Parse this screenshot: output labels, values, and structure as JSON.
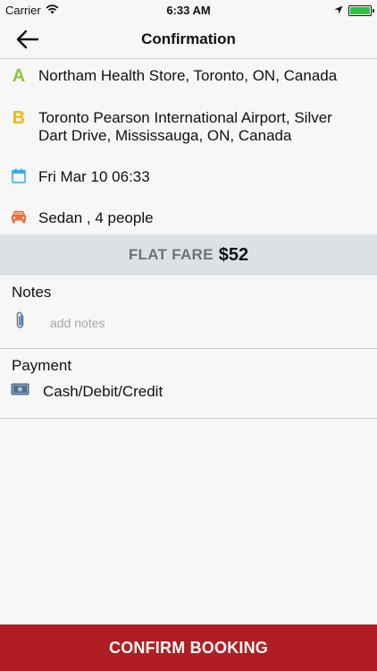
{
  "status_bar": {
    "carrier": "Carrier",
    "time": "6:33 AM"
  },
  "nav": {
    "title": "Confirmation"
  },
  "trip": {
    "pickup_letter": "A",
    "pickup": "Northam Health Store, Toronto, ON, Canada",
    "dropoff_letter": "B",
    "dropoff": "Toronto Pearson International Airport, Silver Dart Drive, Mississauga, ON, Canada",
    "datetime": "Fri Mar 10 06:33",
    "vehicle": "Sedan , 4 people"
  },
  "fare": {
    "label": "FLAT FARE",
    "amount": "$52"
  },
  "notes": {
    "title": "Notes",
    "placeholder": "add notes",
    "value": ""
  },
  "payment": {
    "title": "Payment",
    "method": "Cash/Debit/Credit"
  },
  "confirm": {
    "label": "CONFIRM BOOKING"
  },
  "colors": {
    "pickup": "#8cc63f",
    "dropoff": "#f5b800",
    "calendar": "#3aa9e0",
    "car": "#f26b3a",
    "confirm_bg": "#b01e23",
    "fare_bg": "#dde1e4",
    "battery": "#2bc440"
  },
  "icons": [
    "wifi-icon",
    "location-arrow-icon",
    "battery-icon",
    "back-arrow-icon",
    "calendar-icon",
    "car-icon",
    "paperclip-icon",
    "cash-icon"
  ]
}
